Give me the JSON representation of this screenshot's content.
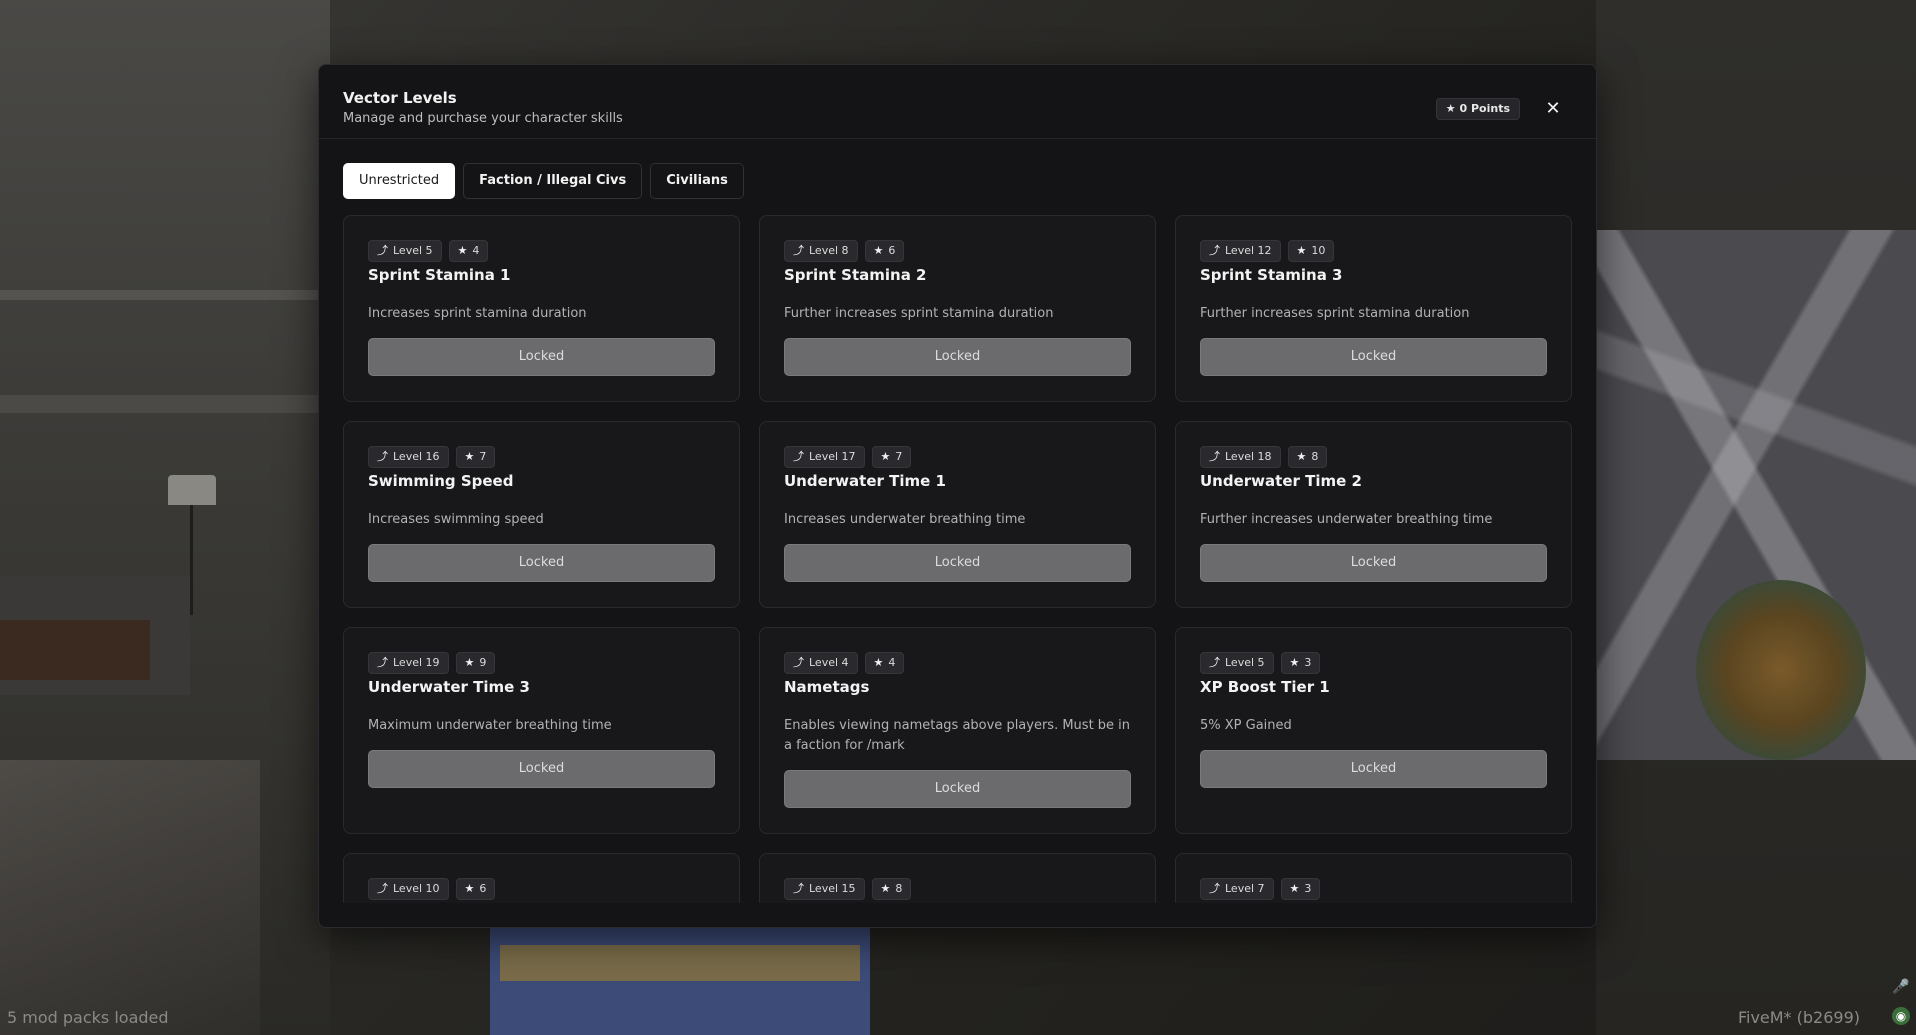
{
  "background": {
    "status_left": "5 mod packs loaded",
    "status_right": "FiveM* (b2699)"
  },
  "modal": {
    "title": "Vector Levels",
    "subtitle": "Manage and purchase your character skills",
    "points_label": "0 Points",
    "close_label": "✕"
  },
  "tabs": [
    {
      "label": "Unrestricted",
      "active": true
    },
    {
      "label": "Faction / Illegal Civs",
      "active": false
    },
    {
      "label": "Civilians",
      "active": false
    }
  ],
  "icons": {
    "level": "level-up-arrow-icon",
    "cost": "star-icon"
  },
  "skills": [
    {
      "level": "Level 5",
      "cost": "4",
      "title": "Sprint Stamina 1",
      "description": "Increases sprint stamina duration",
      "button": "Locked"
    },
    {
      "level": "Level 8",
      "cost": "6",
      "title": "Sprint Stamina 2",
      "description": "Further increases sprint stamina duration",
      "button": "Locked"
    },
    {
      "level": "Level 12",
      "cost": "10",
      "title": "Sprint Stamina 3",
      "description": "Further increases sprint stamina duration",
      "button": "Locked"
    },
    {
      "level": "Level 16",
      "cost": "7",
      "title": "Swimming Speed",
      "description": "Increases swimming speed",
      "button": "Locked"
    },
    {
      "level": "Level 17",
      "cost": "7",
      "title": "Underwater Time 1",
      "description": "Increases underwater breathing time",
      "button": "Locked"
    },
    {
      "level": "Level 18",
      "cost": "8",
      "title": "Underwater Time 2",
      "description": "Further increases underwater breathing time",
      "button": "Locked"
    },
    {
      "level": "Level 19",
      "cost": "9",
      "title": "Underwater Time 3",
      "description": "Maximum underwater breathing time",
      "button": "Locked"
    },
    {
      "level": "Level 4",
      "cost": "4",
      "title": "Nametags",
      "description": "Enables viewing nametags above players. Must be in a faction for /mark",
      "button": "Locked"
    },
    {
      "level": "Level 5",
      "cost": "3",
      "title": "XP Boost Tier 1",
      "description": "5% XP Gained",
      "button": "Locked"
    },
    {
      "level": "Level 10",
      "cost": "6"
    },
    {
      "level": "Level 15",
      "cost": "8"
    },
    {
      "level": "Level 7",
      "cost": "3"
    }
  ]
}
